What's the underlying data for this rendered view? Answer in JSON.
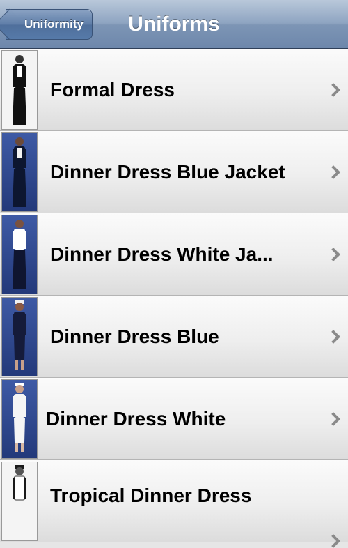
{
  "navbar": {
    "back_label": "Uniformity",
    "title": "Uniforms"
  },
  "list": {
    "items": [
      {
        "label": "Formal Dress",
        "thumb_bg": "white",
        "uniform_color": "#111111",
        "shirt_color": "#ffffff"
      },
      {
        "label": "Dinner Dress Blue Jacket",
        "thumb_bg": "blue",
        "uniform_color": "#0d1630",
        "shirt_color": "#f2f2f2"
      },
      {
        "label": "Dinner Dress White Ja...",
        "thumb_bg": "blue",
        "uniform_color": "#0f1530",
        "shirt_color": "#ffffff"
      },
      {
        "label": "Dinner Dress Blue",
        "thumb_bg": "blue",
        "uniform_color": "#151b3a",
        "shirt_color": "#d9d9d9"
      },
      {
        "label": "Dinner Dress White",
        "thumb_bg": "blue",
        "uniform_color": "#f5f5f5",
        "shirt_color": "#ffffff"
      },
      {
        "label": "Tropical Dinner Dress",
        "thumb_bg": "white",
        "uniform_color": "#1a1a1a",
        "shirt_color": "#ffffff"
      }
    ]
  }
}
